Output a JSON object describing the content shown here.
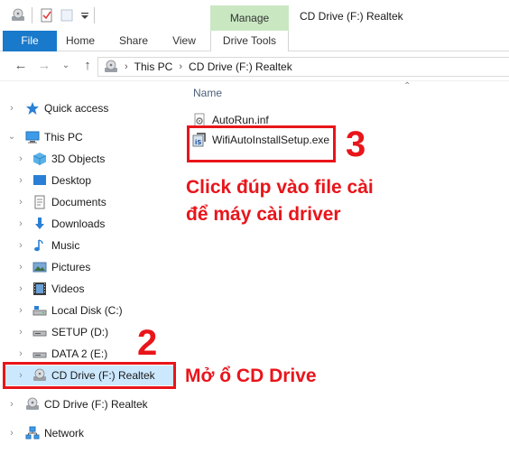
{
  "titlebar": {
    "manage_label": "Manage",
    "window_title": "CD Drive (F:) Realtek"
  },
  "ribbon": {
    "tabs": [
      "File",
      "Home",
      "Share",
      "View",
      "Drive Tools"
    ]
  },
  "address": {
    "crumbs": [
      "This PC",
      "CD Drive (F:) Realtek"
    ]
  },
  "navpane": {
    "items": [
      {
        "label": "Quick access",
        "icon": "star-icon"
      },
      {
        "label": "This PC",
        "icon": "computer-icon"
      },
      {
        "label": "3D Objects",
        "icon": "cube-icon"
      },
      {
        "label": "Desktop",
        "icon": "desktop-icon"
      },
      {
        "label": "Documents",
        "icon": "document-icon"
      },
      {
        "label": "Downloads",
        "icon": "download-icon"
      },
      {
        "label": "Music",
        "icon": "music-icon"
      },
      {
        "label": "Pictures",
        "icon": "picture-icon"
      },
      {
        "label": "Videos",
        "icon": "video-icon"
      },
      {
        "label": "Local Disk (C:)",
        "icon": "disk-icon"
      },
      {
        "label": "SETUP (D:)",
        "icon": "drive-icon"
      },
      {
        "label": "DATA 2 (E:)",
        "icon": "drive-icon"
      },
      {
        "label": "CD Drive (F:) Realtek",
        "icon": "cd-drive-icon"
      },
      {
        "label": "CD Drive (F:) Realtek",
        "icon": "cd-drive-icon"
      },
      {
        "label": "Network",
        "icon": "network-icon"
      }
    ]
  },
  "content": {
    "column_header": "Name",
    "files": [
      {
        "name": "AutoRun.inf",
        "icon": "settings-file-icon"
      },
      {
        "name": "WifiAutoInstallSetup.exe",
        "icon": "installer-icon"
      }
    ]
  },
  "annotations": {
    "step2_number": "2",
    "step2_text": "Mở ổ CD Drive",
    "step3_number": "3",
    "step3_line1": "Click đúp vào file cài",
    "step3_line2": "để máy cài driver"
  },
  "colors": {
    "accent": "#1979ca",
    "annotation_red": "#e8151b",
    "selection": "#cce8ff",
    "manage_tab": "#c9e8c2"
  }
}
